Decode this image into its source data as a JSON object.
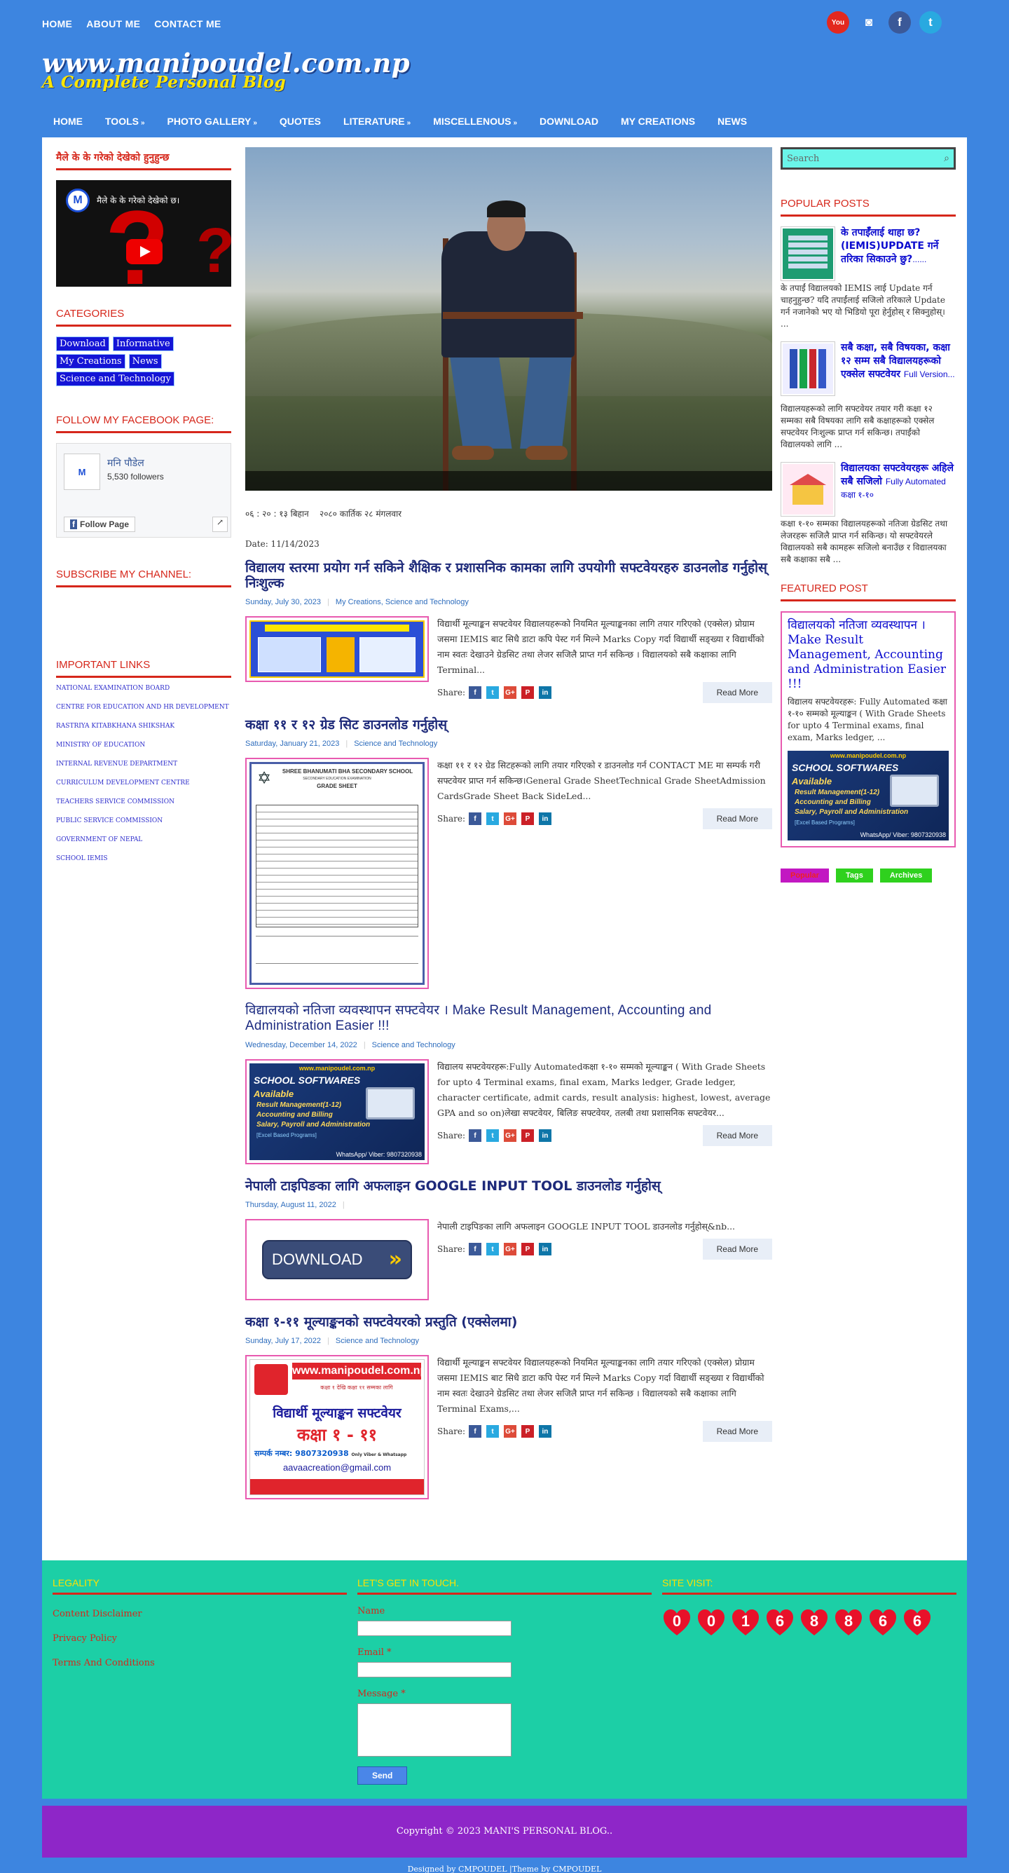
{
  "top_nav": [
    "HOME",
    "ABOUT ME",
    "CONTACT ME"
  ],
  "social": [
    {
      "name": "youtube-icon",
      "glyph": "You",
      "color": "#e3281f"
    },
    {
      "name": "instagram-icon",
      "glyph": "◙",
      "color": "#3d85e0"
    },
    {
      "name": "facebook-icon",
      "glyph": "f",
      "color": "#3b5998"
    },
    {
      "name": "twitter-icon",
      "glyph": "t",
      "color": "#29a9e0"
    }
  ],
  "logo": {
    "line1": "www.manipoudel.com.np",
    "line2": "A Complete Personal Blog"
  },
  "main_nav": [
    {
      "label": "HOME",
      "arrow": ""
    },
    {
      "label": "TOOLS",
      "arrow": "»"
    },
    {
      "label": "PHOTO GALLERY",
      "arrow": "»"
    },
    {
      "label": "QUOTES",
      "arrow": ""
    },
    {
      "label": "LITERATURE",
      "arrow": "»"
    },
    {
      "label": "MISCELLENOUS",
      "arrow": "»"
    },
    {
      "label": "DOWNLOAD",
      "arrow": ""
    },
    {
      "label": "MY CREATIONS",
      "arrow": ""
    },
    {
      "label": "NEWS",
      "arrow": ""
    }
  ],
  "left": {
    "video_widget_title": "मैले के के गरेको देखेको हुनुहुन्छ",
    "video_title": "मैले के के गरेको देखेको छ।",
    "categories_title": "CATEGORIES",
    "categories": [
      "Download",
      "Informative",
      "My Creations",
      "News",
      "Science and Technology"
    ],
    "facebook_title": "FOLLOW MY FACEBOOK PAGE:",
    "fb_name": "मनि पौडेल",
    "fb_followers": "5,530 followers",
    "fb_follow": "Follow Page",
    "subscribe_title": "SUBSCRIBE MY CHANNEL:",
    "links_title": "IMPORTANT LINKS",
    "links": [
      "NATIONAL EXAMINATION BOARD",
      "CENTRE FOR EDUCATION AND HR DEVELOPMENT",
      "RASTRIYA KITABKHANA SHIKSHAK",
      "MINISTRY OF EDUCATION",
      "INTERNAL REVENUE DEPARTMENT",
      "CURRICULUM DEVELOPMENT CENTRE",
      "TEACHERS SERVICE COMMISSION",
      "PUBLIC SERVICE COMMISSION",
      "GOVERNMENT OF NEPAL",
      "SCHOOL IEMIS"
    ]
  },
  "center": {
    "datetime": "०६ : २० : १३ बिहान    २०८० कार्तिक २८ मंगलवार",
    "date_line": "Date: 11/14/2023",
    "share_label": "Share:",
    "read_more": "Read More",
    "posts": [
      {
        "title": "विद्यालय स्तरमा प्रयोग गर्न सकिने शैक्षिक र प्रशासनिक कामका लागि उपयोगी सफ्टवेयरहरु डाउनलोड गर्नुहोस् निःशुल्क",
        "date": "Sunday, July 30, 2023",
        "labels": "My Creations, Science and Technology",
        "text": "विद्यार्थी मूल्याङ्कन सफ्टवेयर विद्यालयहरूको नियमित मूल्याङ्कनका लागि तयार गरिएको (एक्सेल) प्रोग्राम जसमा IEMIS बाट सिधै डाटा  कपि पेस्ट गर्न मिल्ने Marks Copy गर्दा विद्यार्थी सङ्ख्या र विद्यार्थीको नाम स्वतः देखाउने ग्रेडसिट तथा लेजर सजिलै प्राप्त गर्न सकिन्छ । विद्यालयको सबै कक्षाका लागि Terminal..."
      },
      {
        "title": "कक्षा ११ र १२ ग्रेड सिट डाउनलोड गर्नुहोस्",
        "date": "Saturday, January 21, 2023",
        "labels": "Science and Technology",
        "text": "कक्षा ११ र १२ ग्रेड सिटहरूको लागि तयार गरिएको र डाउनलोड गर्न CONTACT ME मा सम्पर्क गरी सफ्टवेयर प्राप्त गर्न सकिन्छ।General Grade SheetTechnical Grade SheetAdmission CardsGrade Sheet Back SideLed..."
      },
      {
        "title": "विद्यालयको नतिजा व्यवस्थापन सफ्टवेयर । Make Result Management, Accounting and Administration Easier !!!",
        "date": "Wednesday, December 14, 2022",
        "labels": "Science and Technology",
        "text": "विद्यालय सफ्टवेयरहरू:Fully Automatedकक्षा १-१० सम्मको मूल्याङ्कन ( With Grade Sheets for upto 4 Terminal exams, final exam, Marks ledger, Grade ledger, character certificate, admit cards, result analysis: highest, lowest, average GPA and so on)लेखा सफ्टवेयर, बिलिङ सफ्टवेयर, तलबी तथा प्रशासनिक सफ्टवेयर..."
      },
      {
        "title": "नेपाली टाइपिङका लागि अफलाइन GOOGLE INPUT TOOL डाउनलोड गर्नुहोस्",
        "date": "Thursday, August 11, 2022",
        "labels": "",
        "text": "नेपाली टाइपिङका लागि अफलाइन GOOGLE INPUT TOOL डाउनलोड गर्नुहोस्&nb..."
      },
      {
        "title": "कक्षा १-११ मूल्याङ्कनको सफ्टवेयरको प्रस्तुति (एक्सेलमा)",
        "date": "Sunday, July 17, 2022",
        "labels": "Science and Technology",
        "text": "विद्यार्थी मूल्याङ्कन सफ्टवेयर विद्यालयहरूको नियमित मूल्याङ्कनका लागि तयार गरिएको (एक्सेल) प्रोग्राम जसमा IEMIS बाट सिधै डाटा  कपि पेस्ट गर्न मिल्ने Marks Copy गर्दा विद्यार्थी सङ्ख्या र विद्यार्थीको नाम स्वतः देखाउने ग्रेडसिट तथा लेजर सजिलै प्राप्त गर्न सकिन्छ । विद्यालयको सबै कक्षाका लागि Terminal Exams,..."
      }
    ]
  },
  "right": {
    "search_placeholder": "Search",
    "popular_title": "POPULAR POSTS",
    "popular": [
      {
        "title": "के तपाईँलाई थाहा छ? (IEMIS)UPDATE गर्ने तरिका सिकाउने छु?",
        "small": "......",
        "desc": "    के तपाईं विद्यालयको IEMIS लाई Update गर्न चाहनुहुन्छ? यदि तपाईंलाई सजिलो तरिकाले Update गर्न नजानेको भए यो भिडियो पूरा हेर्नुहोस् र सिक्नुहोस्।  ..."
      },
      {
        "title": "सबै कक्षा, सबै विषयका, कक्षा १२ सम्म सबै विद्यालयहरूको एक्सेल सफ्टवेयर",
        "small": "Full Version...",
        "desc": "विद्यालयहरूको लागि सफ्टवेयर तयार गरी कक्षा १२ सम्मका सबै विषयका लागि सबै कक्षाहरूको एक्सेल सफ्टवेयर निःशुल्क प्राप्त गर्न सकिन्छ। तपाईंको विद्यालयको लागि ..."
      },
      {
        "title": "विद्यालयका सफ्टवेयरहरू अहिले सबै सजिलो",
        "small": "Fully Automated कक्षा १-१०",
        "desc": "कक्षा १-१० सम्मका विद्यालयहरूको नतिजा ग्रेडसिट तथा लेजरहरू सजिलै प्राप्त गर्न सकिन्छ। यो सफ्टवेयरले विद्यालयको सबै कामहरू सजिलो बनाउँछ र विद्यालयका सबै कक्षाका सबै ..."
      }
    ],
    "featured_title": "FEATURED POST",
    "featured_post_title": "विद्यालयको नतिजा व्यवस्थापन । Make Result Management, Accounting and Administration Easier !!!",
    "featured_text": "   विद्यालय सफ्टवेयरहरू: Fully Automated कक्षा १-१० सम्मको मूल्याङ्कन ( With Grade Sheets for upto 4 Terminal exams, final exam, Marks ledger, ...",
    "tabs": [
      "Popular",
      "Tags",
      "Archives"
    ]
  },
  "school_softwares": {
    "url": "www.manipoudel.com.np",
    "title": "SCHOOL SOFTWARES",
    "available": "Available",
    "items": [
      "Result Management(1-12)",
      "Accounting and Billing",
      "Salary, Payroll and Administration"
    ],
    "note": "[Excel Based Programs]",
    "phone": "WhatsApp/ Viber: 9807320938"
  },
  "grade_sheet": {
    "school": "SHREE BHANUMATI BHA SECONDARY SCHOOL",
    "exam": "SECONDARY EDUCATION EXAMINATION",
    "title": "GRADE SHEET"
  },
  "download_btn": "DOWNLOAD",
  "student_sw": {
    "url": "www.manipoudel.com.np",
    "title": "विद्यार्थी मूल्याङ्कन सफ्टवेयर",
    "grade": "कक्षा १ - ११",
    "phone": "सम्पर्क नम्बर: 9807320938",
    "phone_note": "Only Viber & Whatsapp",
    "email": "aavaacreation@gmail.com",
    "tagline": "कक्षा १ देखि कक्षा ११ सम्मका लागि"
  },
  "footer": {
    "legality_title": "LEGALITY",
    "legal_links": [
      "Content Disclaimer",
      "Privacy Policy",
      "Terms And Conditions"
    ],
    "contact_title": "LET'S GET IN TOUCH.",
    "name_label": "Name",
    "email_label": "Email *",
    "message_label": "Message *",
    "send": "Send",
    "visits_title": "SITE VISIT:",
    "visit_digits": [
      "0",
      "0",
      "1",
      "6",
      "8",
      "8",
      "6",
      "6"
    ]
  },
  "copyright": "Copyright © 2023 MANI'S PERSONAL BLOG..",
  "credit": "Designed by CMPOUDEL |Theme by CMPOUDEL"
}
